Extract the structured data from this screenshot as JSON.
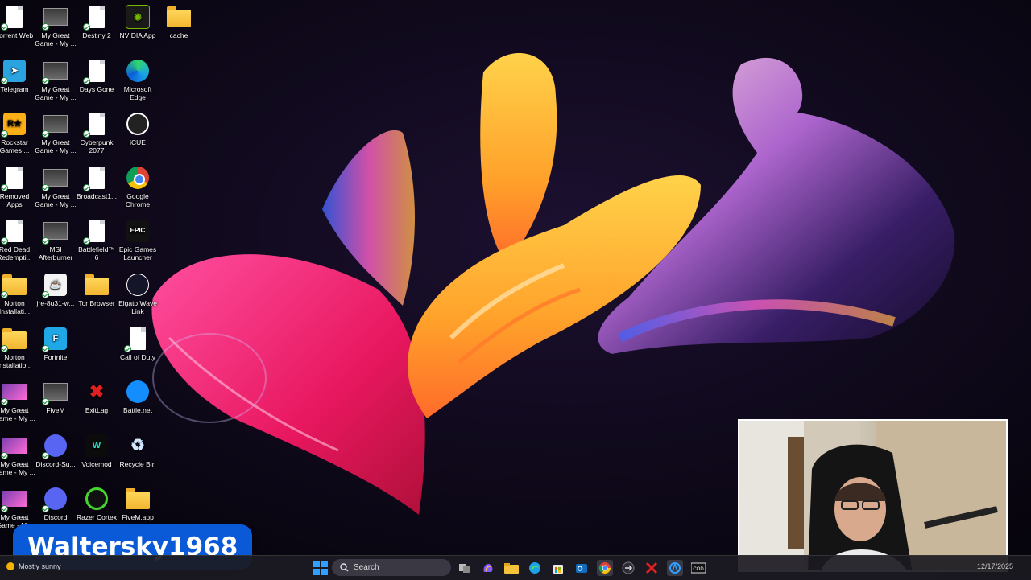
{
  "desktop": {
    "icons": [
      {
        "id": "torrent",
        "label": "Torrent Web",
        "col": 0,
        "row": 0,
        "kind": "file"
      },
      {
        "id": "game1",
        "label": "My Great Game - My ...",
        "col": 1,
        "row": 0,
        "kind": "shot"
      },
      {
        "id": "destiny",
        "label": "Destiny 2",
        "col": 2,
        "row": 0,
        "kind": "file"
      },
      {
        "id": "nvidia",
        "label": "NVIDIA App",
        "col": 3,
        "row": 0,
        "kind": "nvidia"
      },
      {
        "id": "cache",
        "label": "cache",
        "col": 4,
        "row": 0,
        "kind": "folder"
      },
      {
        "id": "telegram",
        "label": "Telegram",
        "col": 0,
        "row": 1,
        "kind": "telegram"
      },
      {
        "id": "game2",
        "label": "My Great Game - My ...",
        "col": 1,
        "row": 1,
        "kind": "shot"
      },
      {
        "id": "daysgone",
        "label": "Days Gone",
        "col": 2,
        "row": 1,
        "kind": "file"
      },
      {
        "id": "edge",
        "label": "Microsoft Edge",
        "col": 3,
        "row": 1,
        "kind": "edge"
      },
      {
        "id": "rockstar",
        "label": "Rockstar Games ...",
        "col": 0,
        "row": 2,
        "kind": "rockstar"
      },
      {
        "id": "game3",
        "label": "My Great Game - My ...",
        "col": 1,
        "row": 2,
        "kind": "shot"
      },
      {
        "id": "cyberpunk",
        "label": "Cyberpunk 2077",
        "col": 2,
        "row": 2,
        "kind": "file"
      },
      {
        "id": "icue",
        "label": "iCUE",
        "col": 3,
        "row": 2,
        "kind": "icue"
      },
      {
        "id": "removed",
        "label": "Removed Apps",
        "col": 0,
        "row": 3,
        "kind": "file"
      },
      {
        "id": "game4",
        "label": "My Great Game - My ...",
        "col": 1,
        "row": 3,
        "kind": "shot"
      },
      {
        "id": "broadcast",
        "label": "Broadcast1...",
        "col": 2,
        "row": 3,
        "kind": "file"
      },
      {
        "id": "chrome",
        "label": "Google Chrome",
        "col": 3,
        "row": 3,
        "kind": "chrome"
      },
      {
        "id": "rdr",
        "label": "Red Dead Redempti...",
        "col": 0,
        "row": 4,
        "kind": "file"
      },
      {
        "id": "msi",
        "label": "MSI Afterburner",
        "col": 1,
        "row": 4,
        "kind": "shot"
      },
      {
        "id": "bf6",
        "label": "Battlefield™ 6",
        "col": 2,
        "row": 4,
        "kind": "file"
      },
      {
        "id": "epic",
        "label": "Epic Games Launcher",
        "col": 3,
        "row": 4,
        "kind": "epic"
      },
      {
        "id": "norton1",
        "label": "Norton Installati...",
        "col": 0,
        "row": 5,
        "kind": "folder"
      },
      {
        "id": "jre",
        "label": "jre-8u31-w...",
        "col": 1,
        "row": 5,
        "kind": "jre"
      },
      {
        "id": "tor",
        "label": "Tor Browser",
        "col": 2,
        "row": 5,
        "kind": "folder"
      },
      {
        "id": "elgato",
        "label": "Elgato Wave Link",
        "col": 3,
        "row": 5,
        "kind": "elgato"
      },
      {
        "id": "norton2",
        "label": "Norton Installatio...",
        "col": 0,
        "row": 6,
        "kind": "folder"
      },
      {
        "id": "fortnite",
        "label": "Fortnite",
        "col": 1,
        "row": 6,
        "kind": "fortnite"
      },
      {
        "id": "cod",
        "label": "Call of Duty",
        "col": 3,
        "row": 6,
        "kind": "file"
      },
      {
        "id": "game5",
        "label": "My Great Game - My ...",
        "col": 0,
        "row": 7,
        "kind": "game"
      },
      {
        "id": "fivem",
        "label": "FiveM",
        "col": 1,
        "row": 7,
        "kind": "shot"
      },
      {
        "id": "exitlag",
        "label": "ExitLag",
        "col": 2,
        "row": 7,
        "kind": "exitlag"
      },
      {
        "id": "battlenet",
        "label": "Battle.net",
        "col": 3,
        "row": 7,
        "kind": "battlenet"
      },
      {
        "id": "game6",
        "label": "My Great Game - My ...",
        "col": 0,
        "row": 8,
        "kind": "game"
      },
      {
        "id": "discord_su",
        "label": "Discord-Su...",
        "col": 1,
        "row": 8,
        "kind": "discord"
      },
      {
        "id": "voicemod",
        "label": "Voicemod",
        "col": 2,
        "row": 8,
        "kind": "voicemod"
      },
      {
        "id": "recycle",
        "label": "Recycle Bin",
        "col": 3,
        "row": 8,
        "kind": "recycle"
      },
      {
        "id": "game7",
        "label": "My Great Game - M...",
        "col": 0,
        "row": 9,
        "kind": "game"
      },
      {
        "id": "discord",
        "label": "Discord",
        "col": 1,
        "row": 9,
        "kind": "discord"
      },
      {
        "id": "razer",
        "label": "Razer Cortex",
        "col": 2,
        "row": 9,
        "kind": "razer"
      },
      {
        "id": "fivemapp",
        "label": "FiveM.app",
        "col": 3,
        "row": 9,
        "kind": "folder"
      }
    ]
  },
  "overlay": {
    "streamer_name": "Waltersky1968"
  },
  "taskbar": {
    "weather_text": "Mostly sunny",
    "search_placeholder": "Search",
    "clock_text": "12/17/2025",
    "pinned": [
      {
        "name": "start-button",
        "icon": "windows-icon"
      },
      {
        "name": "task-view-button",
        "icon": "task-view-icon"
      },
      {
        "name": "copilot-button",
        "icon": "copilot-icon"
      },
      {
        "name": "file-explorer-button",
        "icon": "folder-icon"
      },
      {
        "name": "edge-button",
        "icon": "edge-icon"
      },
      {
        "name": "store-button",
        "icon": "store-icon"
      },
      {
        "name": "outlook-button",
        "icon": "outlook-icon"
      },
      {
        "name": "chrome-button",
        "icon": "chrome-icon"
      },
      {
        "name": "app-button",
        "icon": "arrow-icon"
      },
      {
        "name": "exitlag-button",
        "icon": "exitlag-icon"
      },
      {
        "name": "battlenet-button",
        "icon": "battlenet-icon"
      },
      {
        "name": "cod-button",
        "icon": "call-of-duty-icon"
      }
    ]
  }
}
